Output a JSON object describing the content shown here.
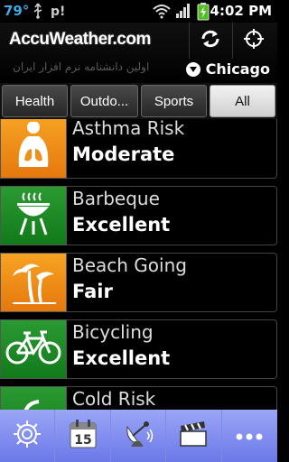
{
  "status_bar": {
    "temperature": "79°",
    "time": "4:02 PM"
  },
  "header": {
    "brand": "AccuWeather.com",
    "watermark": "اولین دانشنامه نرم افزار ایران",
    "city": "Chicago"
  },
  "tabs": [
    {
      "label": "Health",
      "active": false
    },
    {
      "label": "Outdo...",
      "active": false
    },
    {
      "label": "Sports",
      "active": false
    },
    {
      "label": "All",
      "active": true
    }
  ],
  "indices": [
    {
      "name": "Asthma Risk",
      "value": "Moderate",
      "color": "#f0901c",
      "icon": "lungs-icon"
    },
    {
      "name": "Barbeque",
      "value": "Excellent",
      "color": "#1f8a27",
      "icon": "grill-icon"
    },
    {
      "name": "Beach Going",
      "value": "Fair",
      "color": "#f0901c",
      "icon": "palm-tree-icon"
    },
    {
      "name": "Bicycling",
      "value": "Excellent",
      "color": "#1f8a27",
      "icon": "bicycle-icon"
    },
    {
      "name": "Cold Risk",
      "value": "",
      "color": "#1f8a27",
      "icon": "cold-icon"
    }
  ],
  "bottom_bar": [
    "settings-icon",
    "calendar-icon",
    "radar-icon",
    "video-icon",
    "more-icon"
  ],
  "calendar_day": "15"
}
